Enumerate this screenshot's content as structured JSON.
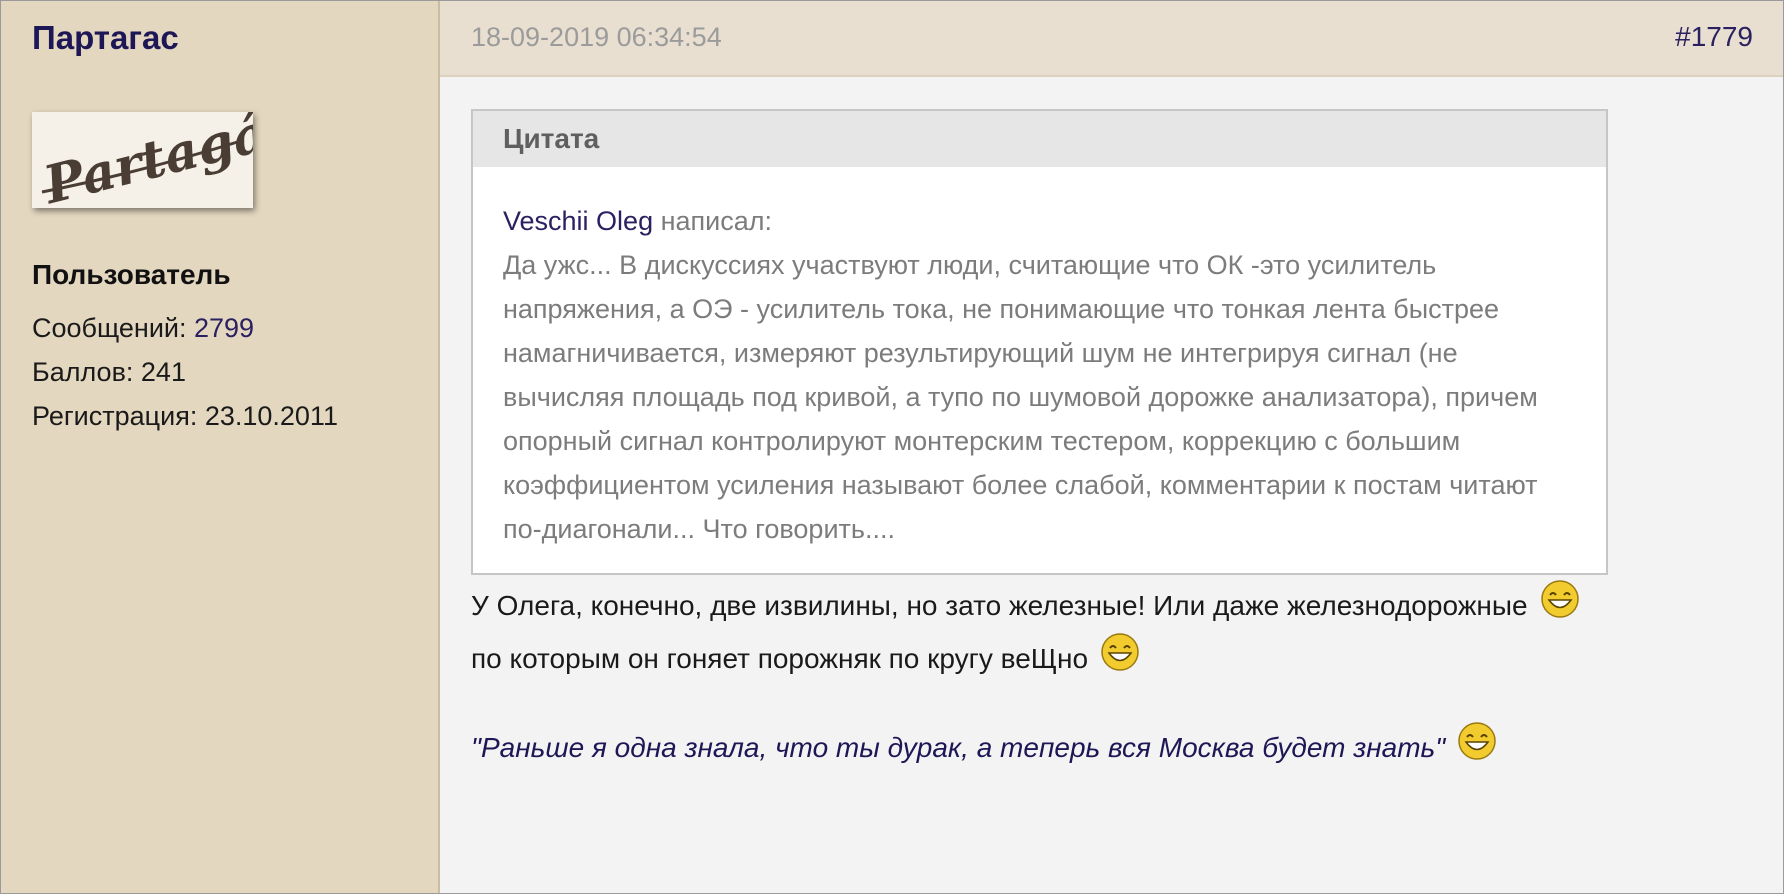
{
  "sidebar": {
    "username": "Партагас",
    "avatar_alt": "Partagás",
    "role": "Пользователь",
    "posts_label": "Сообщений: ",
    "posts_value": "2799",
    "points_label": "Баллов: 241",
    "registration_label": "Регистрация: 23.10.2011"
  },
  "post": {
    "date": "18-09-2019 06:34:54",
    "number": "#1779",
    "quote": {
      "header": "Цитата",
      "author": "Veschii Oleg",
      "wrote": " написал:",
      "text": "Да ужс... В дискуссиях участвуют люди, считающие что ОК -это усилитель напряжения, а ОЭ - усилитель тока, не понимающие что тонкая лента быстрее намагничивается, измеряют результирующий шум не интегрируя сигнал (не вычисляя площадь под кривой, а тупо по шумовой дорожке анализатора), причем опорный сигнал контролируют монтерским тестером, коррекцию с большим коэффициентом усиления называют более слабой, комментарии к постам читают по-диагонали...  Что говорить...."
    },
    "message_part1": "У Олега, конечно, две извилины, но зато железные! Или даже железнодорожные",
    "message_part2": "по которым он гоняет  порожняк по кругу веЩно",
    "signature_quote": "\"Раньше я одна знала, что ты дурак, а теперь вся Москва будет знать\""
  },
  "icons": {
    "smiley": "laughing-smiley-icon"
  },
  "colors": {
    "sidebar_bg": "#e4d7c0",
    "header_bg": "#e8dfd0",
    "link": "#2a2160",
    "quote_text": "#7c7c7c"
  }
}
